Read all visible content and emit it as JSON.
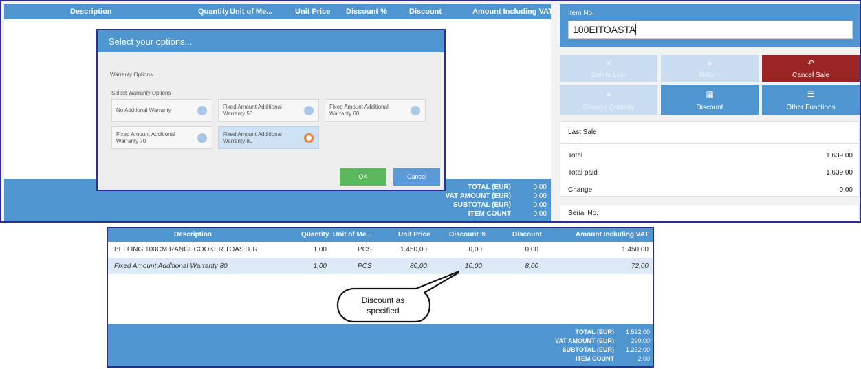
{
  "pos": {
    "columns": [
      "Description",
      "Quantity",
      "Unit of Me...",
      "Unit Price",
      "Discount %",
      "Discount",
      "Amount Including VAT"
    ],
    "totals": [
      {
        "label": "TOTAL (EUR)",
        "value": "0,00"
      },
      {
        "label": "VAT AMOUNT (EUR)",
        "value": "0,00"
      },
      {
        "label": "SUBTOTAL (EUR)",
        "value": "0,00"
      },
      {
        "label": "ITEM COUNT",
        "value": "0,00"
      }
    ]
  },
  "dialog": {
    "title": "Select your options...",
    "section": "Warranty Options",
    "subsection": "Select Warranty Options",
    "options": [
      {
        "line1": "No Addtional Warranty",
        "line2": ""
      },
      {
        "line1": "Fixed Amount Additional",
        "line2": "Warranty 50"
      },
      {
        "line1": "Fixed Amount Additional",
        "line2": "Warranty 60"
      },
      {
        "line1": "Fixed Amount Additional",
        "line2": "Warranty 70"
      },
      {
        "line1": "Fixed Amount Additional",
        "line2": "Warranty 80"
      }
    ],
    "ok_label": "OK",
    "cancel_label": "Cancel"
  },
  "item": {
    "label": "Item No.",
    "value": "100EITOASTA"
  },
  "actions": {
    "delete_line": "Delete Line",
    "return": "Return",
    "cancel_sale": "Cancel Sale",
    "change_quantity": "Change Quantity",
    "discount": "Discount",
    "other_functions": "Other Functions"
  },
  "last_sale": {
    "title": "Last Sale",
    "rows": [
      {
        "label": "Total",
        "value": "1.639,00"
      },
      {
        "label": "Total paid",
        "value": "1.639,00"
      },
      {
        "label": "Change",
        "value": "0,00"
      }
    ]
  },
  "serial": {
    "label": "Serial No."
  },
  "result": {
    "columns": [
      "Description",
      "Quantity",
      "Unit of Me...",
      "Unit Price",
      "Discount %",
      "Discount",
      "Amount Including VAT"
    ],
    "rows": [
      [
        "BELLING 100CM RANGECOOKER TOASTER",
        "1,00",
        "PCS",
        "1.450,00",
        "0,00",
        "0,00",
        "1.450,00"
      ],
      [
        "Fixed Amount Additional Warranty 80",
        "1,00",
        "PCS",
        "80,00",
        "10,00",
        "8,00",
        "72,00"
      ]
    ],
    "totals": [
      {
        "label": "TOTAL (EUR)",
        "value": "1.522,00"
      },
      {
        "label": "VAT AMOUNT (EUR)",
        "value": "290,00"
      },
      {
        "label": "SUBTOTAL (EUR)",
        "value": "1.232,00"
      },
      {
        "label": "ITEM COUNT",
        "value": "2,00"
      }
    ]
  },
  "callout": {
    "line1": "Discount as",
    "line2": "specified"
  }
}
